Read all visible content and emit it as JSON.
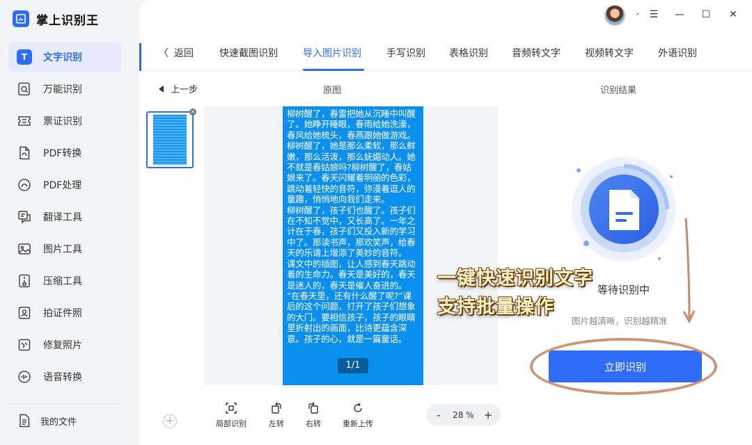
{
  "app": {
    "name": "掌上识别王"
  },
  "sidebar": {
    "items": [
      {
        "label": "文字识别",
        "icon": "text-recognition-icon",
        "active": true
      },
      {
        "label": "万能识别",
        "icon": "universal-recognition-icon"
      },
      {
        "label": "票证识别",
        "icon": "ticket-recognition-icon"
      },
      {
        "label": "PDF转换",
        "icon": "pdf-convert-icon"
      },
      {
        "label": "PDF处理",
        "icon": "pdf-process-icon"
      },
      {
        "label": "翻译工具",
        "icon": "translate-icon"
      },
      {
        "label": "图片工具",
        "icon": "image-tool-icon"
      },
      {
        "label": "压缩工具",
        "icon": "compress-icon"
      },
      {
        "label": "拍证件照",
        "icon": "id-photo-icon"
      },
      {
        "label": "修复照片",
        "icon": "photo-repair-icon"
      },
      {
        "label": "语音转换",
        "icon": "voice-convert-icon"
      }
    ],
    "active_glyph": "T",
    "my_files": "我的文件"
  },
  "titlebar": {
    "menu_dot": "·",
    "menu": "☰",
    "minimize": "—",
    "maximize": "☐",
    "close": "✕"
  },
  "tabs": {
    "back": "返回",
    "items": [
      "快速截图识别",
      "导入图片识别",
      "手写识别",
      "表格识别",
      "音频转文字",
      "视频转文字",
      "外语识别"
    ],
    "active_index": 1
  },
  "workspace": {
    "prev_step": "上一步",
    "original_label": "原图",
    "result_label": "识别结果",
    "page_indicator": "1/1",
    "doc_text": [
      "柳树醒了，春雷把她从沉睡中叫醒了。她睁开睡眼，春雨给她洗澡，春风给她梳头，春燕跟她做游戏。柳树醒了，她是那么柔软，那么鲜嫩，那么活泼，那么妩媚动人。她不就是春姑娘吗?柳树醒了，春姑娘来了。春天闪耀着明丽的色彩，跳动着轻快的音符，弥漫着逗人的童趣，悄悄地向我们走来。",
      "柳树醒了，孩子们也醒了。孩子们在不知不觉中，又长高了。一年之计在于春，孩子们又投入新的学习中了。那读书声，那欢笑声，给春天的乐谱上增添了美妙的音符。",
      "课文中的插图，让人感到春天跳动着的生命力。春天是美好的，春天是迷人的，春天是催人奋进的。",
      "“在春天里，还有什么醒了呢?”课后的这个问题，打开了孩子们想象的大门。要相信孩子，孩子的眼睛里折射出的画面，比诗更蕴含深意。孩子的心，就是一篇童话。"
    ],
    "add": "+"
  },
  "toolbar": {
    "crop": "局部识别",
    "rotate_left": "左转",
    "rotate_right": "右转",
    "reupload": "重新上传",
    "zoom_minus": "-",
    "zoom_value": "28 %",
    "zoom_plus": "+"
  },
  "result": {
    "status": "等待识别中",
    "hint": "图片越清晰，识别越精准",
    "button": "立即识别"
  },
  "annotation": {
    "line1": "一键快速识别文字",
    "line2": "支持批量操作",
    "color": "#cf9476"
  },
  "colors": {
    "accent": "#2f6cf6",
    "doc_bg": "#0b8fee"
  }
}
